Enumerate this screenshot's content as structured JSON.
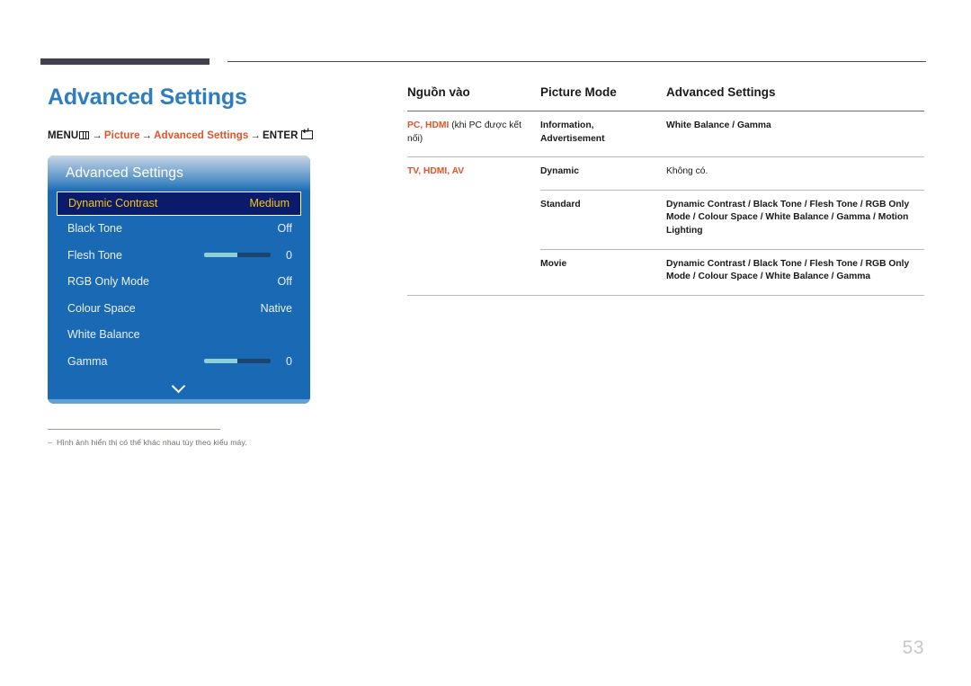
{
  "page": {
    "title": "Advanced Settings",
    "number": "53"
  },
  "breadcrumb": {
    "menu_label": "MENU",
    "menu_icon": "menu-grid-icon",
    "arrow": "→",
    "item1": "Picture",
    "item2": "Advanced Settings",
    "enter_label": "ENTER",
    "enter_icon": "enter-key-icon"
  },
  "osd": {
    "header_title": "Advanced Settings",
    "chevron_icon": "chevron-down-icon",
    "rows": [
      {
        "label": "Dynamic Contrast",
        "value": "Medium",
        "type": "value",
        "selected": true
      },
      {
        "label": "Black Tone",
        "value": "Off",
        "type": "value",
        "selected": false
      },
      {
        "label": "Flesh Tone",
        "value": "0",
        "type": "slider",
        "fill_percent": 50,
        "selected": false
      },
      {
        "label": "RGB Only Mode",
        "value": "Off",
        "type": "value",
        "selected": false
      },
      {
        "label": "Colour Space",
        "value": "Native",
        "type": "value",
        "selected": false
      },
      {
        "label": "White Balance",
        "value": "",
        "type": "value",
        "selected": false
      },
      {
        "label": "Gamma",
        "value": "0",
        "type": "slider",
        "fill_percent": 50,
        "selected": false
      }
    ]
  },
  "footnote": {
    "dash": "‒",
    "text": "Hình ảnh hiển thị có thể khác nhau tùy theo kiểu máy."
  },
  "table": {
    "headers": {
      "col1": "Nguồn vào",
      "col2": "Picture Mode",
      "col3": "Advanced Settings"
    },
    "rows": [
      {
        "source_accent": "PC, HDMI",
        "source_plain": " (khi PC được kết nối)",
        "mode": "Information, Advertisement",
        "settings": "White Balance / Gamma",
        "settings_plain": "",
        "separator": "full"
      },
      {
        "source_accent": "TV, HDMI, AV",
        "source_plain": "",
        "mode": "Dynamic",
        "settings": "",
        "settings_plain": "Không có.",
        "separator": "full"
      },
      {
        "source_accent": "",
        "source_plain": "",
        "mode": "Standard",
        "settings": "Dynamic Contrast / Black Tone / Flesh Tone / RGB Only Mode / Colour Space / White Balance / Gamma / Motion Lighting",
        "settings_plain": "",
        "separator": "partial"
      },
      {
        "source_accent": "",
        "source_plain": "",
        "mode": "Movie",
        "settings": "Dynamic Contrast / Black Tone / Flesh Tone / RGB Only Mode / Colour Space / White Balance / Gamma",
        "settings_plain": "",
        "separator": "partial"
      }
    ]
  },
  "colors": {
    "accent_orange": "#e0542a",
    "title_blue": "#2e7cc2",
    "osd_blue": "#1a69b5",
    "osd_selected_bg": "#0b1b6b",
    "osd_selected_text": "#f5c518",
    "slider_fill": "#8ed0d8",
    "rule_dark": "#44404f"
  }
}
